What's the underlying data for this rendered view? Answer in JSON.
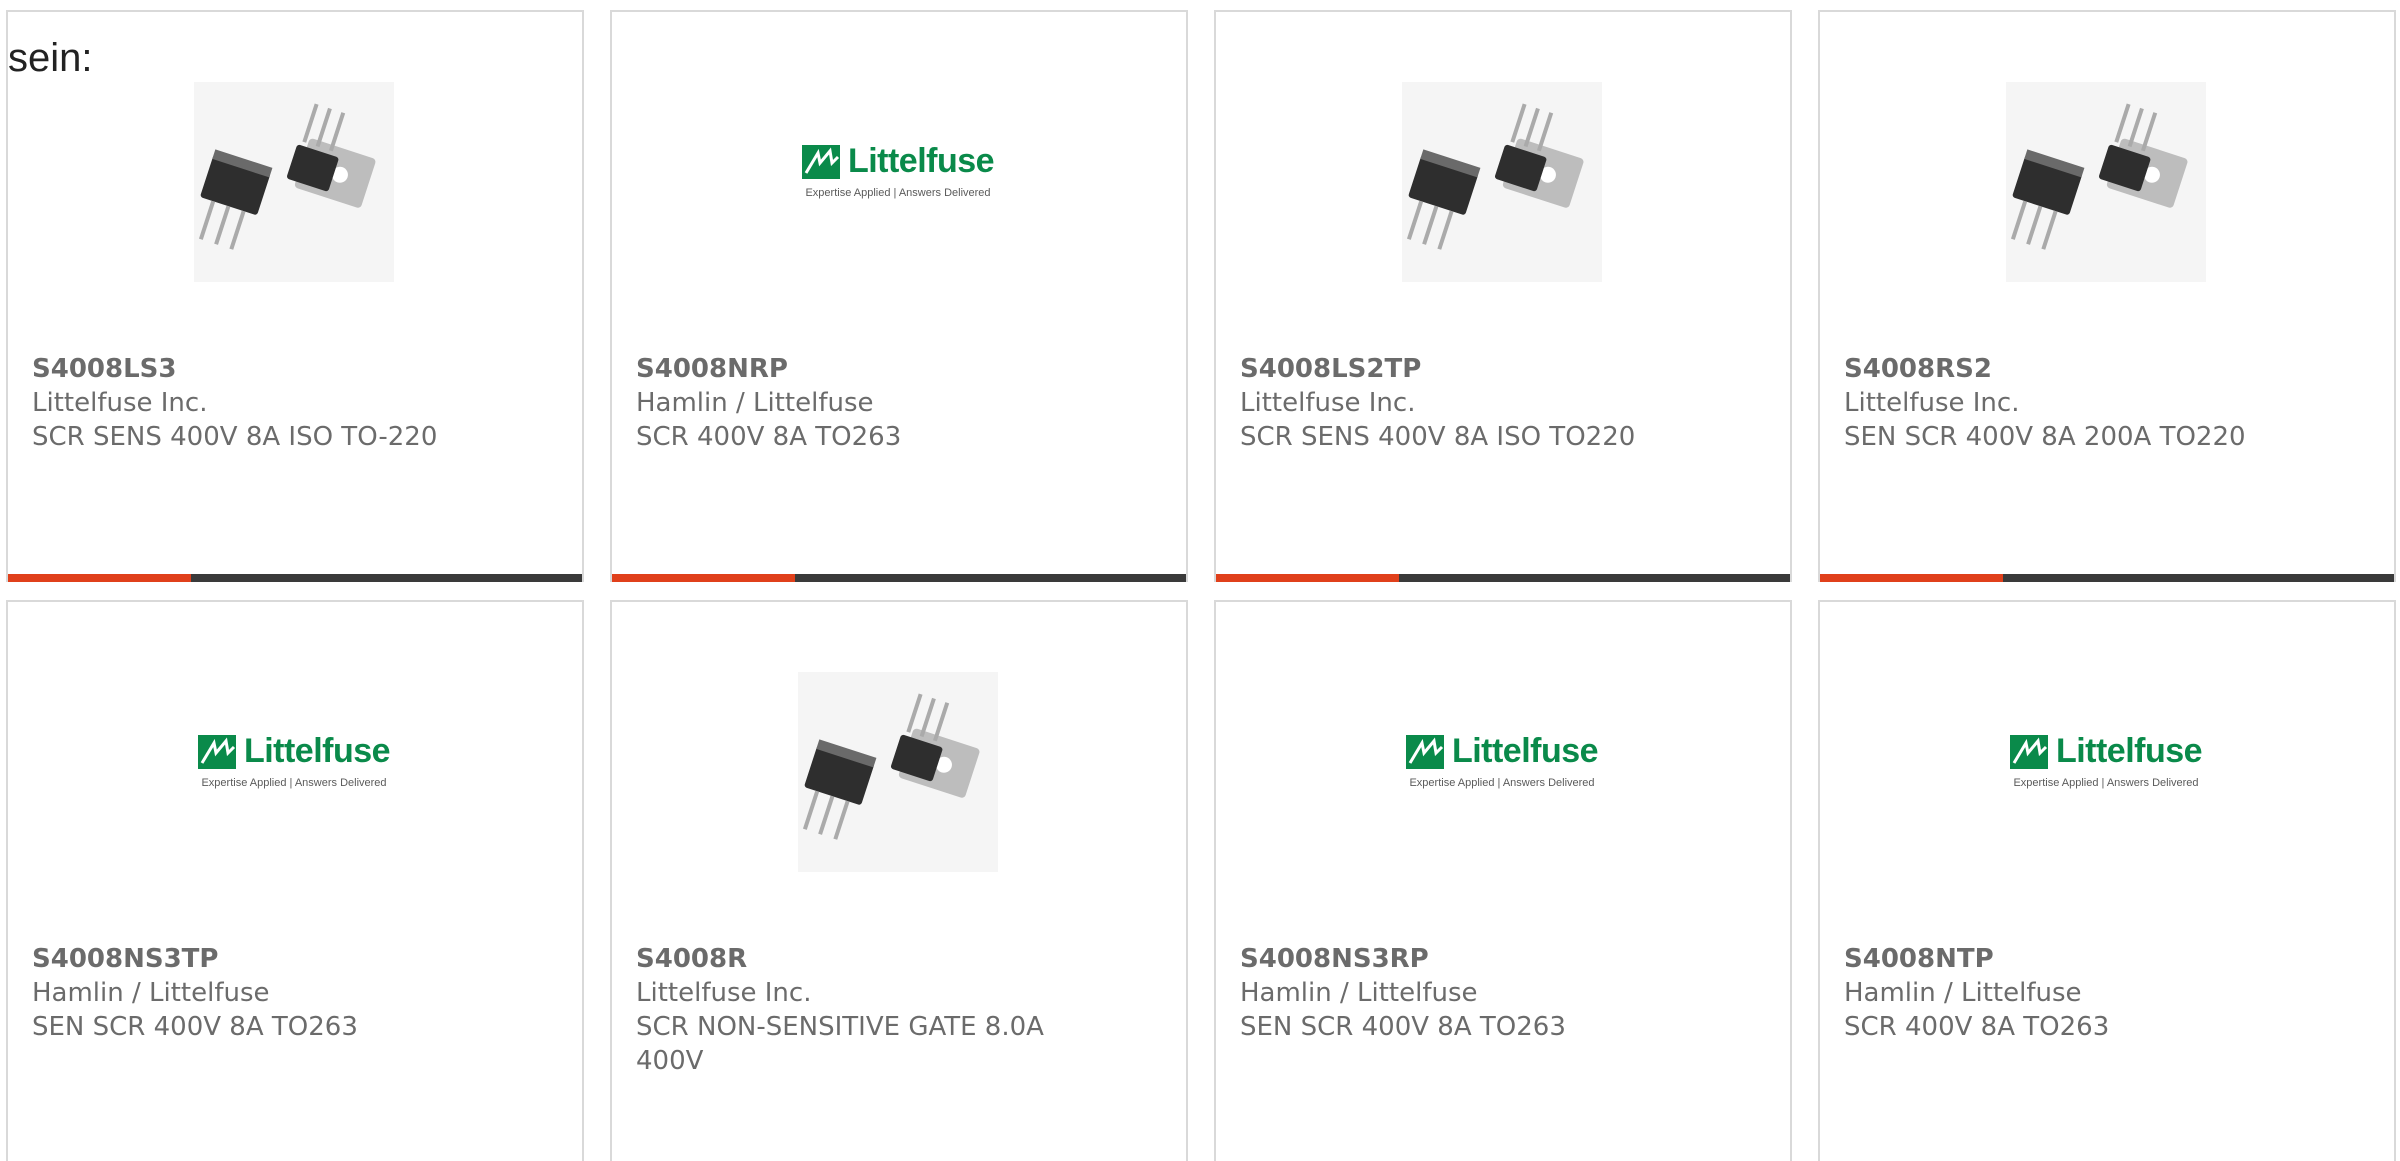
{
  "intro_text": "sein:",
  "logo": {
    "word": "Littelfuse",
    "tagline": "Expertise Applied | Answers Delivered"
  },
  "products": [
    {
      "part_number": "S4008LS3",
      "manufacturer": "Littelfuse Inc.",
      "description": "SCR SENS 400V 8A ISO TO-220",
      "image": "transistor-photo"
    },
    {
      "part_number": "S4008NRP",
      "manufacturer": "Hamlin / Littelfuse",
      "description": "SCR 400V 8A TO263",
      "image": "littelfuse-logo"
    },
    {
      "part_number": "S4008LS2TP",
      "manufacturer": "Littelfuse Inc.",
      "description": "SCR SENS 400V 8A ISO TO220",
      "image": "transistor-photo"
    },
    {
      "part_number": "S4008RS2",
      "manufacturer": "Littelfuse Inc.",
      "description": "SEN SCR 400V 8A 200A TO220",
      "image": "transistor-photo"
    },
    {
      "part_number": "S4008NS3TP",
      "manufacturer": "Hamlin / Littelfuse",
      "description": "SEN SCR 400V 8A TO263",
      "image": "littelfuse-logo"
    },
    {
      "part_number": "S4008R",
      "manufacturer": "Littelfuse Inc.",
      "description": "SCR NON-SENSITIVE GATE 8.0A 400V",
      "image": "transistor-photo"
    },
    {
      "part_number": "S4008NS3RP",
      "manufacturer": "Hamlin / Littelfuse",
      "description": "SEN SCR 400V 8A TO263",
      "image": "littelfuse-logo"
    },
    {
      "part_number": "S4008NTP",
      "manufacturer": "Hamlin / Littelfuse",
      "description": "SCR 400V 8A TO263",
      "image": "littelfuse-logo"
    }
  ],
  "colors": {
    "accent": "#e0401b",
    "bar": "#3a3a3a",
    "brand_green": "#0a8a4a"
  }
}
